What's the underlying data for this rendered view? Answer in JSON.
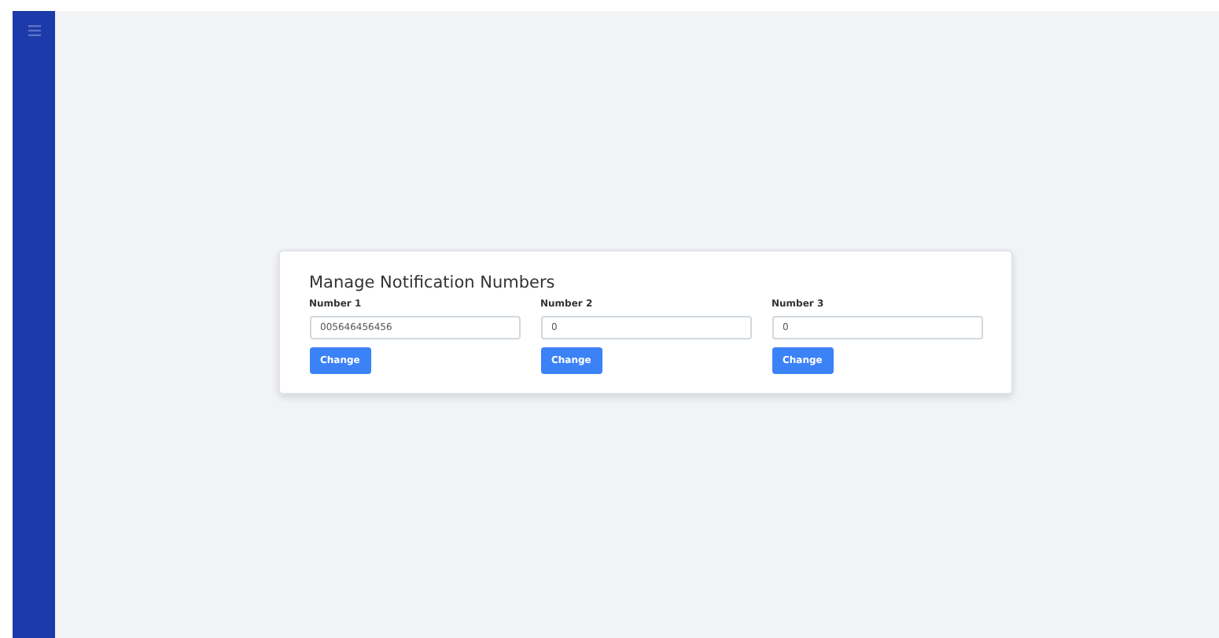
{
  "card": {
    "title": "Manage Notification Numbers",
    "fields": [
      {
        "label": "Number 1",
        "value": "005646456456",
        "button": "Change"
      },
      {
        "label": "Number 2",
        "value": "0",
        "button": "Change"
      },
      {
        "label": "Number 3",
        "value": "0",
        "button": "Change"
      }
    ]
  }
}
